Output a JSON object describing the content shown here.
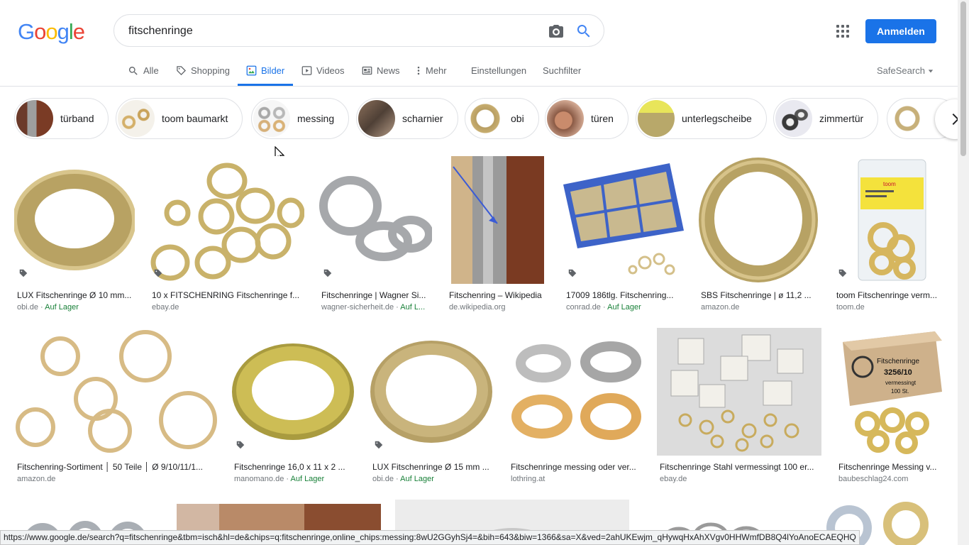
{
  "logo": {
    "text": [
      "G",
      "o",
      "o",
      "g",
      "l",
      "e"
    ],
    "colors": [
      "#4285f4",
      "#ea4335",
      "#fbbc05",
      "#4285f4",
      "#34a853",
      "#ea4335"
    ]
  },
  "search": {
    "value": "fitschenringe"
  },
  "header": {
    "signin_label": "Anmelden"
  },
  "tabs": [
    {
      "label": "Alle",
      "icon": "search-icon"
    },
    {
      "label": "Shopping",
      "icon": "tag-icon"
    },
    {
      "label": "Bilder",
      "icon": "image-icon",
      "active": true
    },
    {
      "label": "Videos",
      "icon": "play-icon"
    },
    {
      "label": "News",
      "icon": "news-icon"
    },
    {
      "label": "Mehr",
      "icon": "more-vert-icon"
    },
    {
      "label": "Einstellungen"
    },
    {
      "label": "Suchfilter"
    }
  ],
  "safesearch": {
    "label": "SafeSearch"
  },
  "chips": [
    {
      "label": "türband"
    },
    {
      "label": "toom baumarkt"
    },
    {
      "label": "messing"
    },
    {
      "label": "scharnier"
    },
    {
      "label": "obi"
    },
    {
      "label": "türen"
    },
    {
      "label": "unterlegscheibe"
    },
    {
      "label": "zimmertür"
    },
    {
      "label": ""
    }
  ],
  "results": [
    {
      "title": "LUX Fitschenringe Ø 10 mm...",
      "source": "obi.de",
      "stock": "Auf Lager"
    },
    {
      "title": "10 x FITSCHENRING Fitschenringe f...",
      "source": "ebay.de",
      "stock": ""
    },
    {
      "title": "Fitschenringe | Wagner Si...",
      "source": "wagner-sicherheit.de",
      "stock": "Auf L..."
    },
    {
      "title": "Fitschenring – Wikipedia",
      "source": "de.wikipedia.org",
      "stock": ""
    },
    {
      "title": "17009 186tlg. Fitschenring...",
      "source": "conrad.de",
      "stock": "Auf Lager"
    },
    {
      "title": "SBS Fitschenringe | ø 11,2 ...",
      "source": "amazon.de",
      "stock": ""
    },
    {
      "title": "toom Fitschenringe verm...",
      "source": "toom.de",
      "stock": ""
    },
    {
      "title": "Fitschenring-Sortiment │ 50 Teile │ Ø 9/10/11/1...",
      "source": "amazon.de",
      "stock": ""
    },
    {
      "title": "Fitschenringe 16,0 x 11 x 2 ...",
      "source": "manomano.de",
      "stock": "Auf Lager"
    },
    {
      "title": "LUX Fitschenringe Ø 15 mm ...",
      "source": "obi.de",
      "stock": "Auf Lager"
    },
    {
      "title": "Fitschenringe messing oder ver...",
      "source": "lothring.at",
      "stock": ""
    },
    {
      "title": "Fitschenringe Stahl vermessingt 100 er...",
      "source": "ebay.de",
      "stock": ""
    },
    {
      "title": "Fitschenringe Messing v...",
      "source": "baubeschlag24.com",
      "stock": ""
    }
  ],
  "image_text": {
    "toom_brand": "toom",
    "box_label": "Fitschenringe",
    "box_number": "3256/10",
    "box_sub1": "vermessingt",
    "box_sub2": "100 St."
  },
  "status_url": "https://www.google.de/search?q=fitschenringe&tbm=isch&hl=de&chips=q:fitschenringe,online_chips:messing:8wU2GGyhSj4=&bih=643&biw=1366&sa=X&ved=2ahUKEwjm_qHywqHxAhXVgv0HHWmfDB8Q4lYoAnoECAEQHQ"
}
